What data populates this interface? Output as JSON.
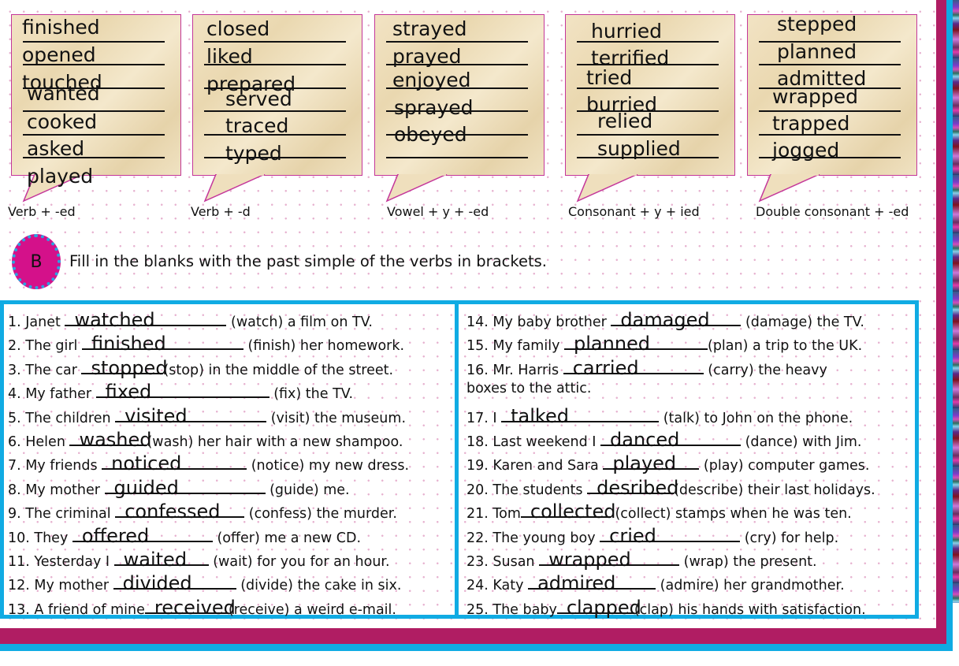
{
  "section_a": {
    "bubbles": [
      {
        "label": "Verb + -ed",
        "words": [
          "finished",
          "opened",
          "touched",
          "wanted",
          "cooked",
          "asked",
          "played"
        ]
      },
      {
        "label": "Verb + -d",
        "words": [
          "closed",
          "liked",
          "prepared",
          "served",
          "traced",
          "typed"
        ]
      },
      {
        "label": "Vowel + y + -ed",
        "words": [
          "strayed",
          "prayed",
          "enjoyed",
          "sprayed",
          "obeyed"
        ]
      },
      {
        "label": "Consonant + y + ied",
        "words": [
          "hurried",
          "terrified",
          "tried",
          "burried",
          "relied",
          "supplied"
        ]
      },
      {
        "label": "Double consonant + -ed",
        "words": [
          "stepped",
          "planned",
          "admitted",
          "wrapped",
          "trapped",
          "jogged"
        ]
      }
    ]
  },
  "section_b": {
    "badge": "B",
    "instruction": "Fill in the blanks with the past simple of the verbs in brackets.",
    "left_items": [
      {
        "pre": "1. Janet ",
        "answer": "watched",
        "post": " (watch) a film on TV."
      },
      {
        "pre": "2. The girl ",
        "answer": "finished",
        "post": " (finish) her homework."
      },
      {
        "pre": "3. The car ",
        "answer": "stopped",
        "post": "(stop) in the middle of the street."
      },
      {
        "pre": "4. My father ",
        "answer": "fixed",
        "post": " (fix) the TV."
      },
      {
        "pre": "5. The children ",
        "answer": "visited",
        "post": " (visit) the museum."
      },
      {
        "pre": "6. Helen ",
        "answer": "washed",
        "post": "(wash) her hair with a new shampoo."
      },
      {
        "pre": "7. My friends ",
        "answer": "noticed",
        "post": " (notice) my new dress."
      },
      {
        "pre": "8. My mother ",
        "answer": "guided",
        "post": " (guide) me."
      },
      {
        "pre": "9. The criminal ",
        "answer": "confessed",
        "post": " (confess) the murder."
      },
      {
        "pre": "10. They ",
        "answer": "offered",
        "post": " (offer) me a new CD."
      },
      {
        "pre": "11. Yesterday I ",
        "answer": "waited",
        "post": " (wait) for you for an hour."
      },
      {
        "pre": "12. My mother ",
        "answer": "divided",
        "post": " (divide) the cake in six."
      },
      {
        "pre": "13. A friend of mine",
        "answer": "received",
        "post": "(receive) a weird e-mail."
      }
    ],
    "right_items": [
      {
        "pre": "14. My baby brother ",
        "answer": "damaged",
        "post": " (damage) the TV."
      },
      {
        "pre": "15. My family ",
        "answer": "planned",
        "post": "(plan) a trip to the UK."
      },
      {
        "pre": "16. Mr. Harris ",
        "answer": "carried",
        "post": " (carry) the heavy"
      },
      {
        "pre": "boxes to the attic.",
        "answer": "",
        "post": ""
      },
      {
        "pre": "17. I ",
        "answer": "talked",
        "post": " (talk) to John on the phone."
      },
      {
        "pre": "18. Last weekend I ",
        "answer": "danced",
        "post": " (dance) with Jim."
      },
      {
        "pre": "19. Karen and Sara ",
        "answer": "played",
        "post": " (play) computer games."
      },
      {
        "pre": "20. The students ",
        "answer": "desribed",
        "post": "(describe) their last holidays."
      },
      {
        "pre": "21. Tom",
        "answer": "collected",
        "post": " (collect) stamps when he was ten."
      },
      {
        "pre": "22. The young boy ",
        "answer": "cried",
        "post": " (cry) for help."
      },
      {
        "pre": "23. Susan ",
        "answer": "wrapped",
        "post": " (wrap) the present."
      },
      {
        "pre": "24. Katy ",
        "answer": "admired",
        "post": " (admire) her grandmother."
      },
      {
        "pre": "25. The baby",
        "answer": "clapped",
        "post": "(clap) his hands with satisfaction."
      }
    ]
  },
  "colors": {
    "magenta": "#b01d63",
    "cyan": "#10abe3",
    "badge": "#d4118a",
    "bubble_border": "#c4379a"
  }
}
